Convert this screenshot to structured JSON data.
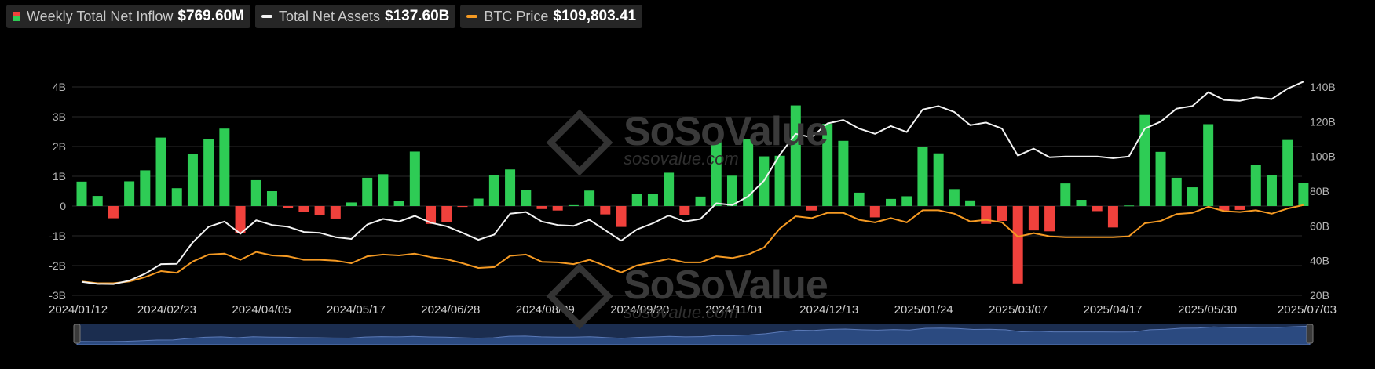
{
  "legend": [
    {
      "label": "Weekly Total Net Inflow",
      "value": "$769.60M",
      "icon": "bar-swatch-icon"
    },
    {
      "label": "Total Net Assets",
      "value": "$137.60B",
      "icon": "line-swatch-icon"
    },
    {
      "label": "BTC Price",
      "value": "$109,803.41",
      "icon": "line-swatch-icon"
    }
  ],
  "watermark": {
    "brand": "SoSoValue",
    "site": "sosovalue.com"
  },
  "colors": {
    "positive": "#2ecc55",
    "negative": "#f0413c",
    "assets": "#f2f2f2",
    "price": "#f59a23",
    "grid": "#2a2a2a",
    "navigator": "#1b2d4f"
  },
  "chart_data": {
    "type": "bar",
    "y_left": {
      "min": -3,
      "max": 4,
      "ticks": [
        "4B",
        "3B",
        "2B",
        "1B",
        "0",
        "-1B",
        "-2B",
        "-3B"
      ]
    },
    "y_right": {
      "min": 20,
      "max": 140,
      "ticks": [
        "140B",
        "120B",
        "100B",
        "80B",
        "60B",
        "40B",
        "20B"
      ]
    },
    "x_tick_labels": [
      "2024/01/12",
      "2024/02/23",
      "2024/04/05",
      "2024/05/17",
      "2024/06/28",
      "2024/08/09",
      "2024/09/20",
      "2024/11/01",
      "2024/12/13",
      "2025/01/24",
      "2025/03/07",
      "2025/04/17",
      "2025/05/30",
      "2025/07/03"
    ],
    "grid": true,
    "series": [
      {
        "name": "Weekly Total Net Inflow",
        "type": "bar",
        "axis": "left",
        "values": [
          0.82,
          0.34,
          -0.41,
          0.83,
          1.2,
          2.3,
          0.6,
          1.74,
          2.26,
          2.6,
          -0.92,
          0.87,
          0.5,
          -0.06,
          -0.2,
          -0.3,
          -0.42,
          0.12,
          0.95,
          1.07,
          0.18,
          1.83,
          -0.6,
          -0.55,
          -0.03,
          0.25,
          1.05,
          1.23,
          0.55,
          -0.1,
          -0.15,
          0.03,
          0.52,
          -0.28,
          -0.7,
          0.41,
          0.42,
          1.12,
          -0.3,
          0.32,
          2.15,
          1.02,
          2.24,
          1.67,
          1.69,
          3.38,
          -0.15,
          2.76,
          2.19,
          0.45,
          -0.38,
          0.24,
          0.33,
          1.99,
          1.77,
          0.57,
          0.19,
          -0.6,
          -0.5,
          -2.6,
          -0.82,
          -0.85,
          0.76,
          0.21,
          -0.17,
          -0.72,
          0.02,
          3.06,
          1.82,
          0.95,
          0.63,
          2.75,
          -0.15,
          -0.13,
          1.39,
          1.03,
          2.22,
          0.77
        ]
      },
      {
        "name": "Total Net Assets",
        "type": "line",
        "axis": "right",
        "values": [
          27.8,
          26.6,
          26.5,
          28.5,
          32.5,
          38.0,
          38.2,
          50.5,
          59.5,
          62.5,
          55.5,
          63.2,
          60.5,
          59.5,
          56.5,
          56.0,
          53.5,
          52.5,
          60.8,
          64.0,
          62.5,
          65.8,
          61.8,
          59.8,
          56.0,
          52.0,
          55.0,
          67.0,
          68.0,
          62.5,
          60.5,
          60.0,
          63.5,
          57.5,
          51.5,
          58.0,
          61.5,
          66.0,
          62.5,
          64.0,
          73.0,
          72.0,
          77.0,
          86.0,
          101.0,
          113.0,
          111.0,
          119.0,
          121.0,
          116.0,
          113.0,
          117.5,
          114.0,
          127.0,
          129.0,
          125.5,
          118.0,
          119.5,
          116.0,
          100.5,
          104.5,
          99.5,
          100.0,
          100.0,
          100.0,
          99.0,
          100.0,
          116.0,
          120.0,
          127.5,
          129.0,
          137.0,
          132.5,
          132.0,
          134.0,
          133.0,
          139.0,
          143.0
        ]
      },
      {
        "name": "BTC Price",
        "type": "line",
        "axis": "right",
        "values": [
          28.0,
          27.0,
          27.0,
          28.0,
          30.5,
          34.0,
          33.0,
          39.5,
          43.5,
          44.0,
          40.5,
          45.0,
          43.0,
          42.5,
          40.5,
          40.5,
          40.0,
          38.5,
          42.5,
          43.5,
          43.0,
          44.0,
          42.0,
          40.8,
          38.5,
          35.8,
          36.3,
          42.8,
          43.5,
          39.3,
          39.0,
          38.0,
          40.5,
          37.0,
          33.2,
          37.3,
          39.0,
          41.0,
          39.0,
          39.0,
          42.5,
          41.5,
          43.5,
          47.5,
          58.5,
          65.5,
          64.5,
          67.5,
          67.5,
          63.5,
          62.0,
          64.5,
          62.0,
          69.0,
          69.0,
          67.0,
          62.5,
          63.5,
          62.0,
          53.8,
          55.8,
          54.0,
          53.5,
          53.5,
          53.5,
          53.5,
          54.0,
          61.5,
          62.8,
          66.8,
          67.5,
          71.0,
          68.5,
          68.0,
          69.0,
          67.0,
          70.0,
          72.0
        ]
      }
    ]
  }
}
